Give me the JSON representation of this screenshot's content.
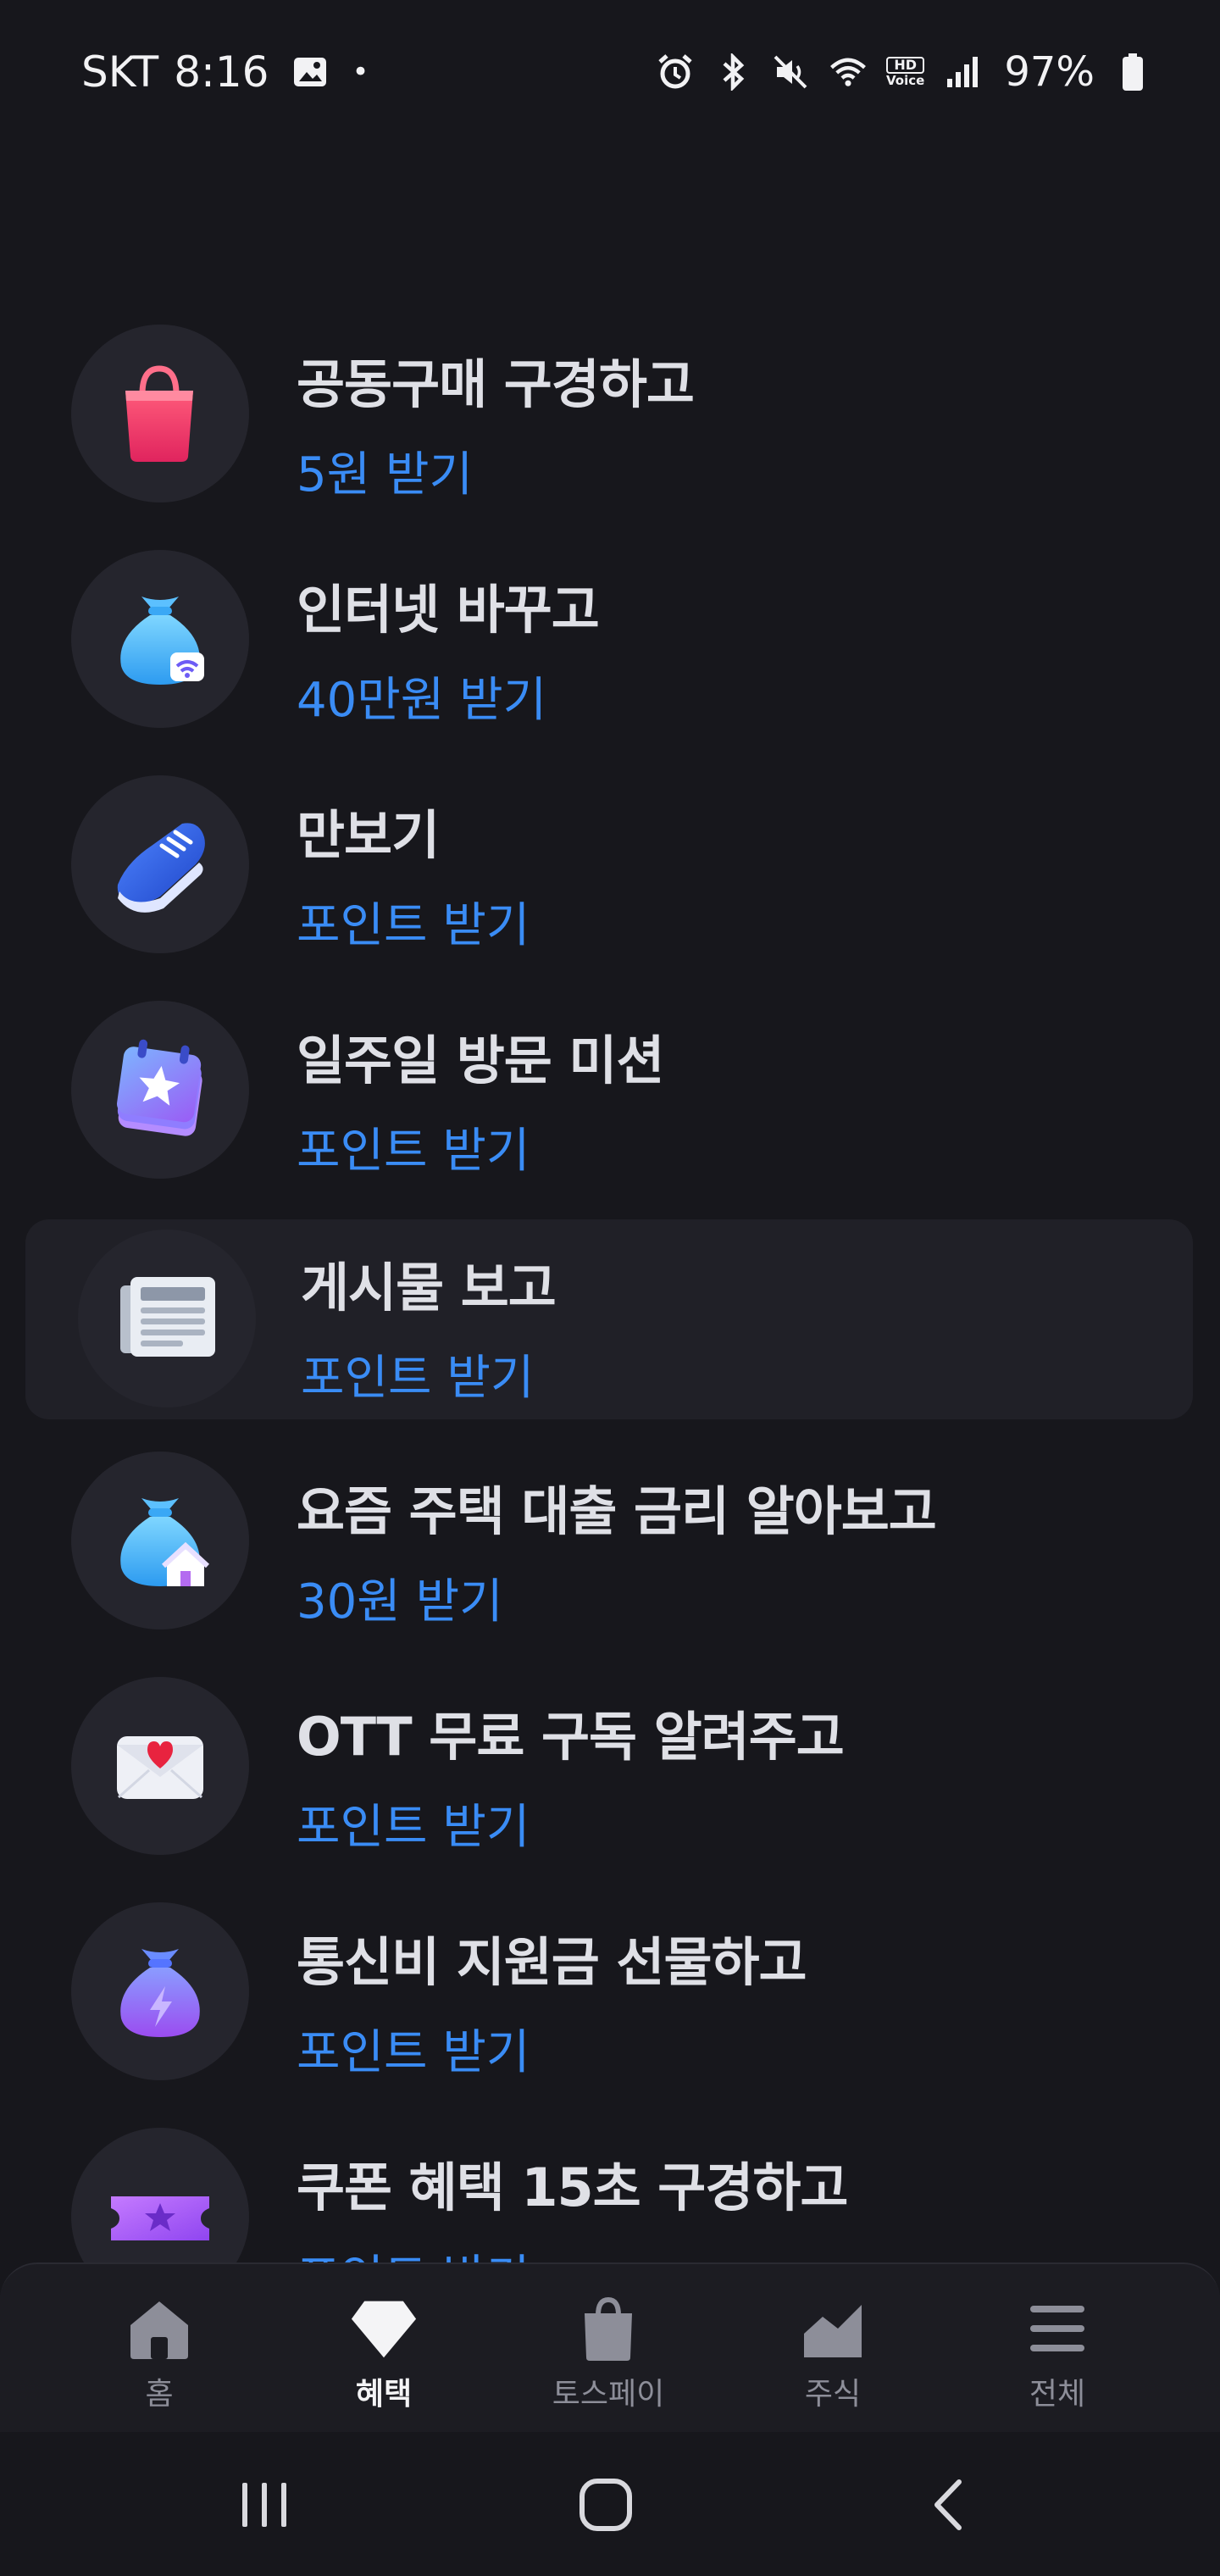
{
  "status_bar": {
    "carrier": "SKT",
    "time": "8:16",
    "dot": "•",
    "hd_top": "HD",
    "hd_bottom": "Voice",
    "battery": "97%"
  },
  "list": {
    "items": [
      {
        "title": "공동구매 구경하고",
        "subtitle": "5원 받기",
        "icon": "shopping-bag-icon"
      },
      {
        "title": "인터넷 바꾸고",
        "subtitle": "40만원 받기",
        "icon": "money-bag-wifi-icon"
      },
      {
        "title": "만보기",
        "subtitle": "포인트 받기",
        "icon": "sneaker-icon"
      },
      {
        "title": "일주일 방문 미션",
        "subtitle": "포인트 받기",
        "icon": "calendar-star-icon"
      },
      {
        "title": "게시물 보고",
        "subtitle": "포인트 받기",
        "icon": "newspaper-icon"
      },
      {
        "title": "요즘 주택 대출 금리 알아보고",
        "subtitle": "30원 받기",
        "icon": "money-bag-house-icon"
      },
      {
        "title": "OTT 무료 구독 알려주고",
        "subtitle": "포인트 받기",
        "icon": "envelope-heart-icon"
      },
      {
        "title": "통신비 지원금 선물하고",
        "subtitle": "포인트 받기",
        "icon": "money-bag-lightning-icon"
      },
      {
        "title": "쿠폰 혜택 15초 구경하고",
        "subtitle": "포인트 받기",
        "icon": "coupon-ticket-icon"
      }
    ]
  },
  "tabbar": {
    "tabs": [
      {
        "label": "홈",
        "icon": "home-icon"
      },
      {
        "label": "혜택",
        "icon": "diamond-icon",
        "active": true
      },
      {
        "label": "토스페이",
        "icon": "shopping-bag-icon"
      },
      {
        "label": "주식",
        "icon": "chart-icon"
      },
      {
        "label": "전체",
        "icon": "menu-icon"
      }
    ]
  },
  "colors": {
    "background": "#17171c",
    "accent_blue": "#3a8cf5",
    "title_text": "#dfe0e6",
    "tab_inactive": "#8d8e99"
  }
}
